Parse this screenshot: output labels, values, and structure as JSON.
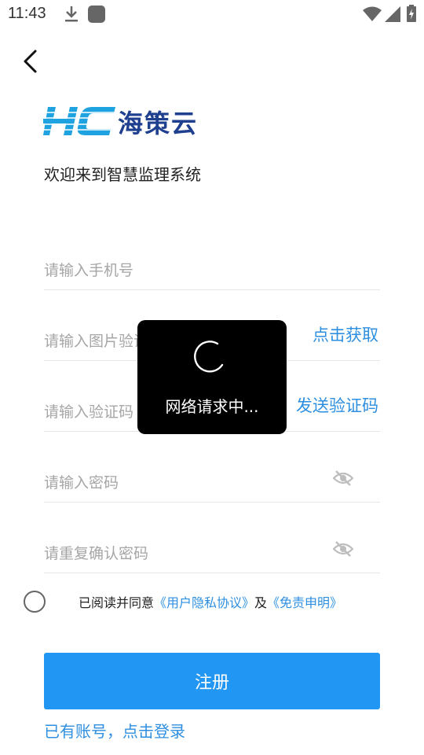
{
  "status_bar": {
    "time": "11:43",
    "icons": [
      "download-icon",
      "app-icon",
      "wifi-icon",
      "signal-icon",
      "battery-charging-icon"
    ]
  },
  "header": {
    "back_icon": "chevron-left-icon"
  },
  "brand": {
    "logo_mark": "HC",
    "logo_text": "海策云",
    "logo_color": "#1f3f8f",
    "logo_mark_color": "#1fa3e0"
  },
  "welcome_text": "欢迎来到智慧监理系统",
  "form": {
    "phone_placeholder": "请输入手机号",
    "captcha_placeholder": "请输入图片验证码",
    "captcha_action": "点击获取",
    "code_placeholder": "请输入验证码",
    "code_action": "发送验证码",
    "password_placeholder": "请输入密码",
    "confirm_placeholder": "请重复确认密码"
  },
  "agreement": {
    "prefix": "已阅读并同意",
    "privacy_link": "《用户隐私协议》",
    "conjunction": "及",
    "disclaimer_link": "《免责申明》"
  },
  "register_label": "注册",
  "login_link": "已有账号，点击登录",
  "loading": {
    "text": "网络请求中..."
  },
  "colors": {
    "accent": "#2196f3",
    "link": "#2e8fe0",
    "toast_bg": "#000000"
  }
}
